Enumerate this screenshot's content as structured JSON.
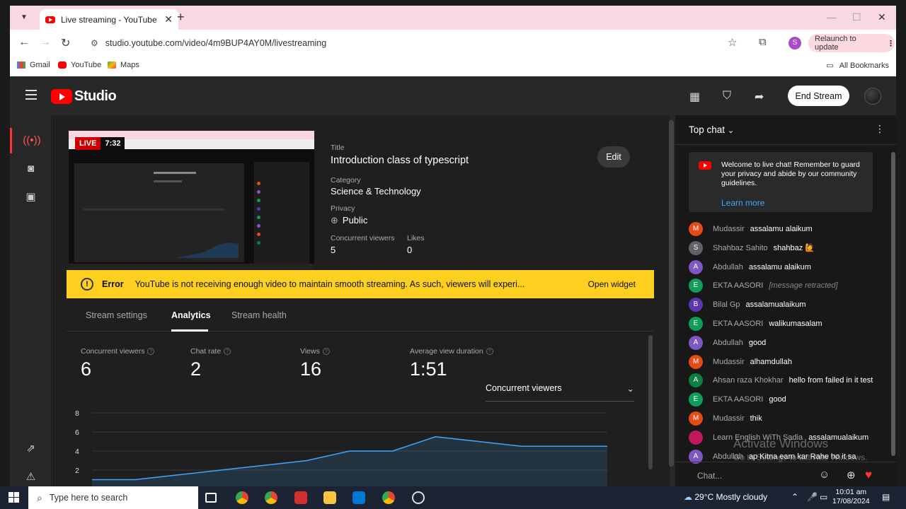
{
  "browser": {
    "tab_title": "Live streaming - YouTube Studio",
    "url": "studio.youtube.com/video/4m9BUP4AY0M/livestreaming",
    "relaunch_label": "Relaunch to update",
    "profile_initial": "S",
    "bookmarks": [
      "Gmail",
      "YouTube",
      "Maps"
    ],
    "all_bookmarks": "All Bookmarks"
  },
  "studio": {
    "wordmark": "Studio",
    "end_stream_label": "End Stream"
  },
  "preview": {
    "live_label": "LIVE",
    "elapsed": "7:32"
  },
  "stream_info": {
    "title_label": "Title",
    "title": "Introduction class of typescript",
    "category_label": "Category",
    "category": "Science & Technology",
    "privacy_label": "Privacy",
    "privacy": "Public",
    "concurrent_label": "Concurrent viewers",
    "concurrent": "5",
    "likes_label": "Likes",
    "likes": "0",
    "edit_label": "Edit"
  },
  "error": {
    "title": "Error",
    "message": "YouTube is not receiving enough video to maintain smooth streaming. As such, viewers will experi...",
    "action": "Open widget"
  },
  "tabs": [
    "Stream settings",
    "Analytics",
    "Stream health"
  ],
  "analytics": {
    "stats": [
      {
        "label": "Concurrent viewers",
        "value": "6"
      },
      {
        "label": "Chat rate",
        "value": "2"
      },
      {
        "label": "Views",
        "value": "16"
      },
      {
        "label": "Average view duration",
        "value": "1:51"
      }
    ],
    "metric_select": "Concurrent viewers"
  },
  "chart_data": {
    "type": "area",
    "y_ticks": [
      "8",
      "6",
      "4",
      "2"
    ],
    "ylim": [
      2,
      8
    ],
    "x": [
      0,
      1,
      2,
      3,
      4,
      5,
      6,
      7,
      8,
      9,
      10,
      11,
      12
    ],
    "values": [
      1,
      1,
      1.5,
      2,
      2.5,
      3,
      4,
      4,
      5.5,
      5,
      4.5,
      4.5,
      4.5
    ],
    "color": "#3ea6ff"
  },
  "chat": {
    "title": "Top chat",
    "welcome": "Welcome to live chat! Remember to guard your privacy and abide by our community guidelines.",
    "learn_more": "Learn more",
    "placeholder": "Chat...",
    "messages": [
      {
        "initial": "M",
        "color": "#e64a19",
        "author": "Mudassir",
        "text": "assalamu alaikum",
        "retracted": false
      },
      {
        "initial": "S",
        "color": "#5f6368",
        "author": "Shahbaz Sahito",
        "text": "shahbaz 🙋",
        "retracted": false
      },
      {
        "initial": "A",
        "color": "#7e57c2",
        "author": "Abdullah",
        "text": "assalamu alaikum",
        "retracted": false
      },
      {
        "initial": "E",
        "color": "#0f9d58",
        "author": "EKTA AASORI",
        "text": "[message retracted]",
        "retracted": true
      },
      {
        "initial": "B",
        "color": "#5e35b1",
        "author": "Bilal Gp",
        "text": "assalamualaikum",
        "retracted": false
      },
      {
        "initial": "E",
        "color": "#0f9d58",
        "author": "EKTA AASORI",
        "text": "walikumasalam",
        "retracted": false
      },
      {
        "initial": "A",
        "color": "#7e57c2",
        "author": "Abdullah",
        "text": "good",
        "retracted": false
      },
      {
        "initial": "M",
        "color": "#e64a19",
        "author": "Mudassir",
        "text": "alhamdullah",
        "retracted": false
      },
      {
        "initial": "A",
        "color": "#0b8043",
        "author": "Ahsan raza Khokhar",
        "text": "hello from failed in it test",
        "retracted": false
      },
      {
        "initial": "E",
        "color": "#0f9d58",
        "author": "EKTA AASORI",
        "text": "good",
        "retracted": false
      },
      {
        "initial": "M",
        "color": "#e64a19",
        "author": "Mudassir",
        "text": "thik",
        "retracted": false
      },
      {
        "initial": "",
        "color": "#c2185b",
        "author": "Learn English WiTh Sadia",
        "text": "assalamualaikum",
        "retracted": false
      },
      {
        "initial": "A",
        "color": "#7e57c2",
        "author": "Abdullah",
        "text": "ap Kitna earn kar Rahe ho it sa",
        "retracted": false
      }
    ]
  },
  "watermark": {
    "line1": "Activate Windows",
    "line2": "Go to Settings to activate Windows."
  },
  "taskbar": {
    "search_placeholder": "Type here to search",
    "weather": "29°C  Mostly cloudy",
    "time": "10:01 am",
    "date": "17/08/2024"
  }
}
